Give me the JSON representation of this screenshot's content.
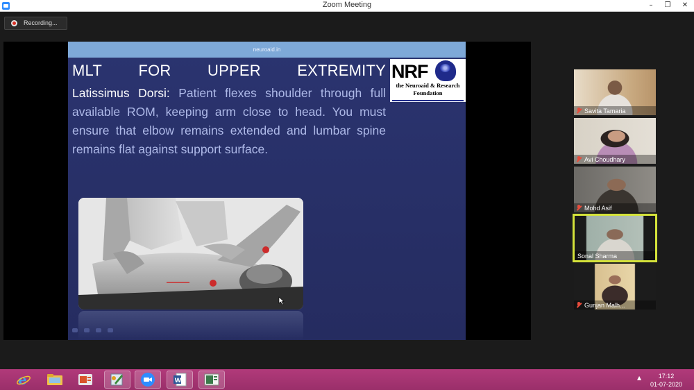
{
  "window": {
    "title": "Zoom Meeting",
    "minimize_glyph": "–",
    "restore_glyph": "❐",
    "close_glyph": "✕"
  },
  "recording": {
    "label": "Recording..."
  },
  "slide": {
    "header": "neuroaid.in",
    "title_words": [
      "MLT",
      "FOR",
      "UPPER",
      "EXTREMITY"
    ],
    "term": "Latissimus Dorsi:",
    "body": " Patient flexes shoulder through full available ROM, keeping arm close to head. You must ensure that elbow remains extended and lumbar spine remains flat against support surface.",
    "logo": {
      "letters": "NRF",
      "tagline_1": "the Neuroaid & Research",
      "tagline_2": "Foundation"
    }
  },
  "participants": [
    {
      "name": "Savita Tamaria",
      "muted": true,
      "active": false
    },
    {
      "name": "Avi Choudhary",
      "muted": true,
      "active": false
    },
    {
      "name": "Mohd Asif",
      "muted": true,
      "active": false
    },
    {
      "name": "Sonal Sharma",
      "muted": false,
      "active": true
    },
    {
      "name": "Gunjan Malh...",
      "muted": true,
      "active": false
    }
  ],
  "taskbar": {
    "apps": [
      "internet-explorer-icon",
      "file-explorer-icon",
      "office-app-icon",
      "paint-app-icon",
      "zoom-app-icon",
      "word-app-icon",
      "media-app-icon"
    ],
    "time": "17:12",
    "date": "01-07-2020"
  },
  "colors": {
    "active_speaker_border": "#d4e23a",
    "taskbar": "#9a2f6a",
    "slide_bg": "#272f66",
    "mute_red": "#e74c3c"
  }
}
